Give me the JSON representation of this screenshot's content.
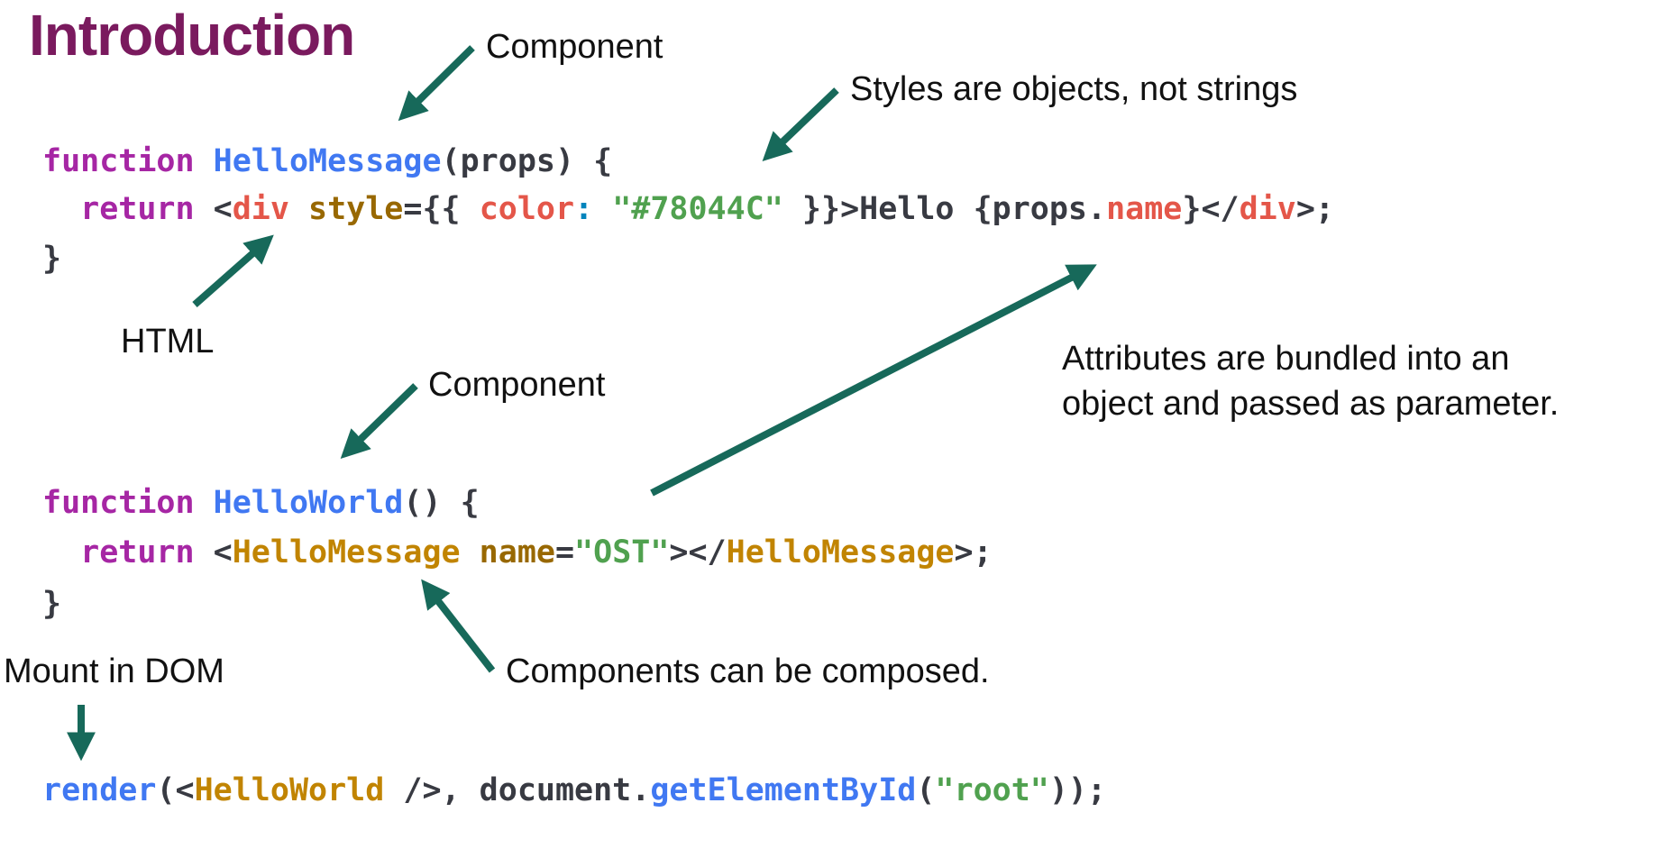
{
  "title": "Introduction",
  "arrow_color": "#17695a",
  "labels": {
    "component_1": "Component",
    "styles": "Styles are objects, not strings",
    "html": "HTML",
    "component_2": "Component",
    "attributes_line1": "Attributes are bundled into an",
    "attributes_line2": "object and passed as parameter.",
    "mount": "Mount in DOM",
    "composed": "Components can be composed."
  },
  "code": [
    [
      [
        "function ",
        "keyword"
      ],
      [
        "HelloMessage",
        "func"
      ],
      [
        "(props) {",
        "plain"
      ]
    ],
    [
      [
        "  return ",
        "keyword"
      ],
      [
        "<",
        "plain"
      ],
      [
        "div",
        "tag"
      ],
      [
        " style",
        "attr"
      ],
      [
        "={{ ",
        "plain"
      ],
      [
        "color",
        "tag"
      ],
      [
        ": ",
        "punct"
      ],
      [
        "\"#78044C\"",
        "string"
      ],
      [
        " }}>Hello {props.",
        "plain"
      ],
      [
        "name",
        "tag"
      ],
      [
        "}</",
        "plain"
      ],
      [
        "div",
        "tag"
      ],
      [
        ">;",
        "plain"
      ]
    ],
    [
      [
        "}",
        "plain"
      ]
    ],
    [
      [
        "function ",
        "keyword"
      ],
      [
        "HelloWorld",
        "func"
      ],
      [
        "() {",
        "plain"
      ]
    ],
    [
      [
        "  return ",
        "keyword"
      ],
      [
        "<",
        "plain"
      ],
      [
        "HelloMessage",
        "comp"
      ],
      [
        " name",
        "attr"
      ],
      [
        "=",
        "plain"
      ],
      [
        "\"OST\"",
        "string"
      ],
      [
        "></",
        "plain"
      ],
      [
        "HelloMessage",
        "comp"
      ],
      [
        ">;",
        "plain"
      ]
    ],
    [
      [
        "}",
        "plain"
      ]
    ],
    [
      [
        "render",
        "func"
      ],
      [
        "(<",
        "plain"
      ],
      [
        "HelloWorld",
        "comp"
      ],
      [
        " />, document.",
        "plain"
      ],
      [
        "getElementById",
        "func"
      ],
      [
        "(",
        "plain"
      ],
      [
        "\"root\"",
        "string"
      ],
      [
        "));",
        "plain"
      ]
    ]
  ]
}
